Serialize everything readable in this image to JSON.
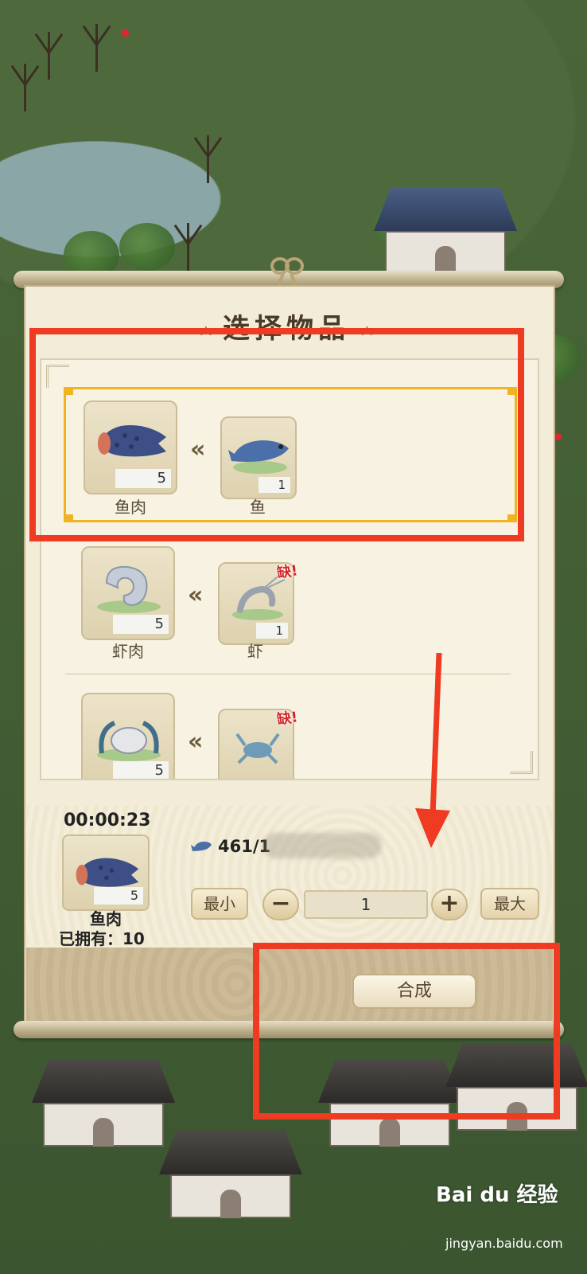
{
  "panel": {
    "title": "选择物品",
    "title_ornament_left": "ㅅ",
    "title_ornament_right": "ㅅ"
  },
  "recipes": [
    {
      "product": "鱼肉",
      "product_count": "5",
      "ingredient": "鱼",
      "ingredient_count": "1",
      "missing": false,
      "selected": true
    },
    {
      "product": "虾肉",
      "product_count": "5",
      "ingredient": "虾",
      "ingredient_count": "1",
      "missing": true,
      "missing_label": "缺!"
    },
    {
      "product_count": "5",
      "missing": true,
      "missing_label": "缺!"
    }
  ],
  "detail": {
    "timer": "00:00:23",
    "item_name": "鱼肉",
    "item_count": "5",
    "owned": "已拥有：10",
    "cost_value": "461/1",
    "min_label": "最小",
    "max_label": "最大",
    "minus_label": "−",
    "plus_label": "+",
    "quantity": "1",
    "craft_label": "合成"
  },
  "icons": {
    "fish_meat": "fish-fillet-icon",
    "fish": "fish-icon",
    "shrimp_meat": "shrimp-meat-icon",
    "shrimp": "shrimp-icon",
    "crab_meat": "crab-meat-icon",
    "crab": "crab-icon",
    "arrow": "double-chevron-left-icon",
    "cost": "fish-icon"
  },
  "colors": {
    "highlight": "#ee3b22",
    "selected_border": "#f2b322",
    "missing": "#d4262a"
  },
  "watermark": {
    "brand": "Bai du 经验",
    "url": "jingyan.baidu.com"
  }
}
